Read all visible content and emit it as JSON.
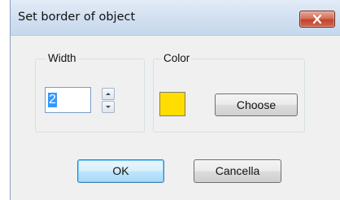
{
  "dialog": {
    "title": "Set border of object",
    "close_icon": "close-x-icon"
  },
  "width_group": {
    "label": "Width",
    "value": "2",
    "up_icon": "arrow-up-icon",
    "down_icon": "arrow-down-icon"
  },
  "color_group": {
    "label": "Color",
    "swatch_color": "#ffdd00",
    "choose_label": "Choose"
  },
  "buttons": {
    "ok_label": "OK",
    "cancel_label": "Cancella"
  }
}
